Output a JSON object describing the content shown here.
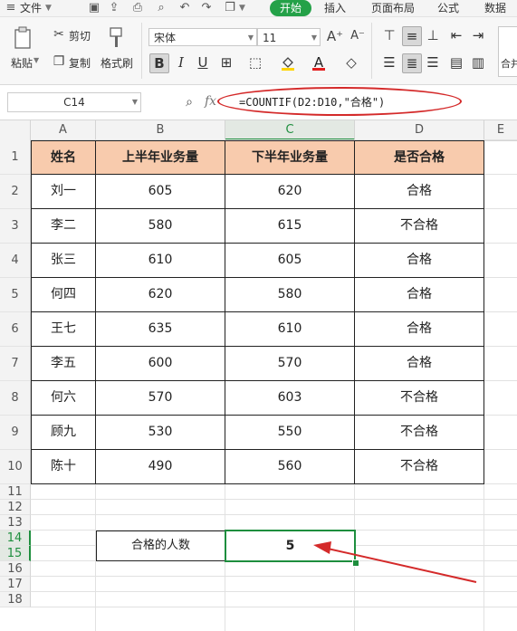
{
  "menu": {
    "file_label": "文件",
    "tabs": [
      "开始",
      "插入",
      "页面布局",
      "公式",
      "数据"
    ]
  },
  "ribbon": {
    "cut_label": "剪切",
    "copy_label": "复制",
    "paste_label": "粘贴",
    "format_painter_label": "格式刷",
    "font_name": "宋体",
    "font_size": "11",
    "merge_label": "合并"
  },
  "formula_bar": {
    "name_box": "C14",
    "fx_label": "fx",
    "formula": "=COUNTIF(D2:D10,\"合格\")"
  },
  "columns": [
    "A",
    "B",
    "C",
    "D",
    "E"
  ],
  "rows": [
    "1",
    "2",
    "3",
    "4",
    "5",
    "6",
    "7",
    "8",
    "9",
    "10",
    "11",
    "12",
    "13",
    "14",
    "15",
    "16",
    "17",
    "18"
  ],
  "table": {
    "headers": [
      "姓名",
      "上半年业务量",
      "下半年业务量",
      "是否合格"
    ],
    "rows": [
      [
        "刘一",
        "605",
        "620",
        "合格"
      ],
      [
        "李二",
        "580",
        "615",
        "不合格"
      ],
      [
        "张三",
        "610",
        "605",
        "合格"
      ],
      [
        "何四",
        "620",
        "580",
        "合格"
      ],
      [
        "王七",
        "635",
        "610",
        "合格"
      ],
      [
        "李五",
        "600",
        "570",
        "合格"
      ],
      [
        "何六",
        "570",
        "603",
        "不合格"
      ],
      [
        "顾九",
        "530",
        "550",
        "不合格"
      ],
      [
        "陈十",
        "490",
        "560",
        "不合格"
      ]
    ]
  },
  "summary": {
    "label": "合格的人数",
    "value": "5"
  },
  "accent_colors": {
    "start_tab": "#24a148",
    "header_fill": "#f8cbad",
    "annotation": "#d42a2a",
    "selection": "#1e8e3e"
  }
}
